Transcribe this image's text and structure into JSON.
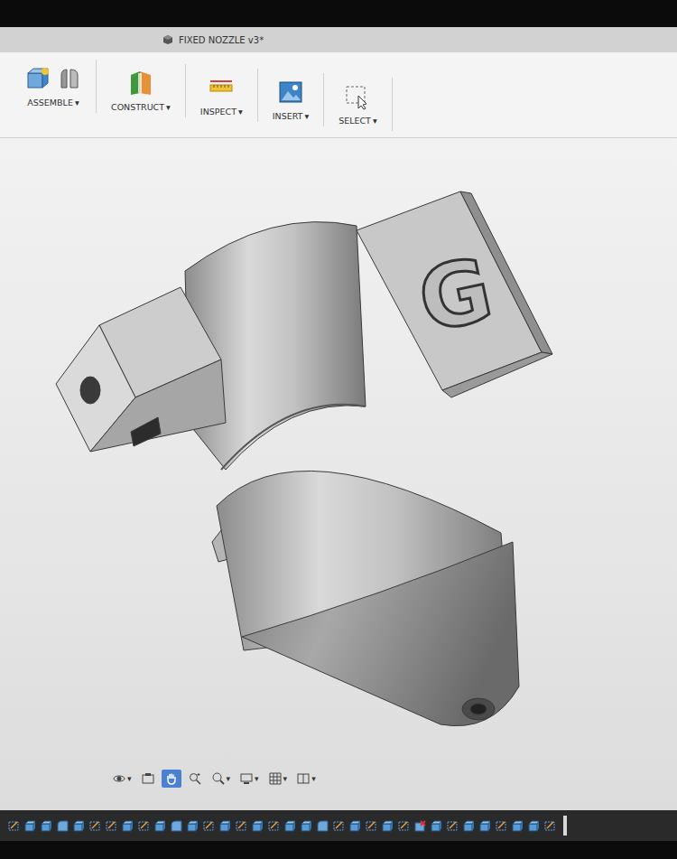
{
  "window": {
    "title": "FIXED NOZZLE v3*"
  },
  "toolbar": {
    "groups": [
      {
        "label": "ASSEMBLE",
        "caret": "▾",
        "icon": "assemble"
      },
      {
        "label": "CONSTRUCT",
        "caret": "▾",
        "icon": "construct"
      },
      {
        "label": "INSPECT",
        "caret": "▾",
        "icon": "inspect"
      },
      {
        "label": "INSERT",
        "caret": "▾",
        "icon": "insert"
      },
      {
        "label": "SELECT",
        "caret": "▾",
        "icon": "select"
      }
    ]
  },
  "viewport": {
    "model": {
      "label": "G"
    }
  },
  "navigation_bar": {
    "items": [
      {
        "icon": "orbit",
        "caret": "▾",
        "selected": false
      },
      {
        "icon": "look",
        "caret": "",
        "selected": false
      },
      {
        "icon": "pan",
        "caret": "",
        "selected": true
      },
      {
        "icon": "zoomwin",
        "caret": "",
        "selected": false
      },
      {
        "icon": "zoom",
        "caret": "▾",
        "selected": false
      },
      {
        "icon": "display",
        "caret": "▾",
        "selected": false
      },
      {
        "icon": "grid",
        "caret": "▾",
        "selected": false
      },
      {
        "icon": "views",
        "caret": "▾",
        "selected": false
      }
    ]
  },
  "timeline": {
    "items": [
      {
        "kind": "sketch"
      },
      {
        "kind": "extrude"
      },
      {
        "kind": "extrude"
      },
      {
        "kind": "fillet"
      },
      {
        "kind": "extrude"
      },
      {
        "kind": "sketch"
      },
      {
        "kind": "sketch"
      },
      {
        "kind": "extrude"
      },
      {
        "kind": "sketch"
      },
      {
        "kind": "extrude"
      },
      {
        "kind": "fillet"
      },
      {
        "kind": "extrude"
      },
      {
        "kind": "sketch"
      },
      {
        "kind": "extrude"
      },
      {
        "kind": "sketch"
      },
      {
        "kind": "extrude"
      },
      {
        "kind": "sketch"
      },
      {
        "kind": "extrude"
      },
      {
        "kind": "extrude"
      },
      {
        "kind": "fillet"
      },
      {
        "kind": "sketch"
      },
      {
        "kind": "extrude"
      },
      {
        "kind": "sketch"
      },
      {
        "kind": "extrude"
      },
      {
        "kind": "sketch"
      },
      {
        "kind": "error"
      },
      {
        "kind": "extrude"
      },
      {
        "kind": "sketch"
      },
      {
        "kind": "extrude"
      },
      {
        "kind": "extrude"
      },
      {
        "kind": "sketch"
      },
      {
        "kind": "extrude"
      },
      {
        "kind": "extrude"
      },
      {
        "kind": "sketch"
      }
    ]
  }
}
